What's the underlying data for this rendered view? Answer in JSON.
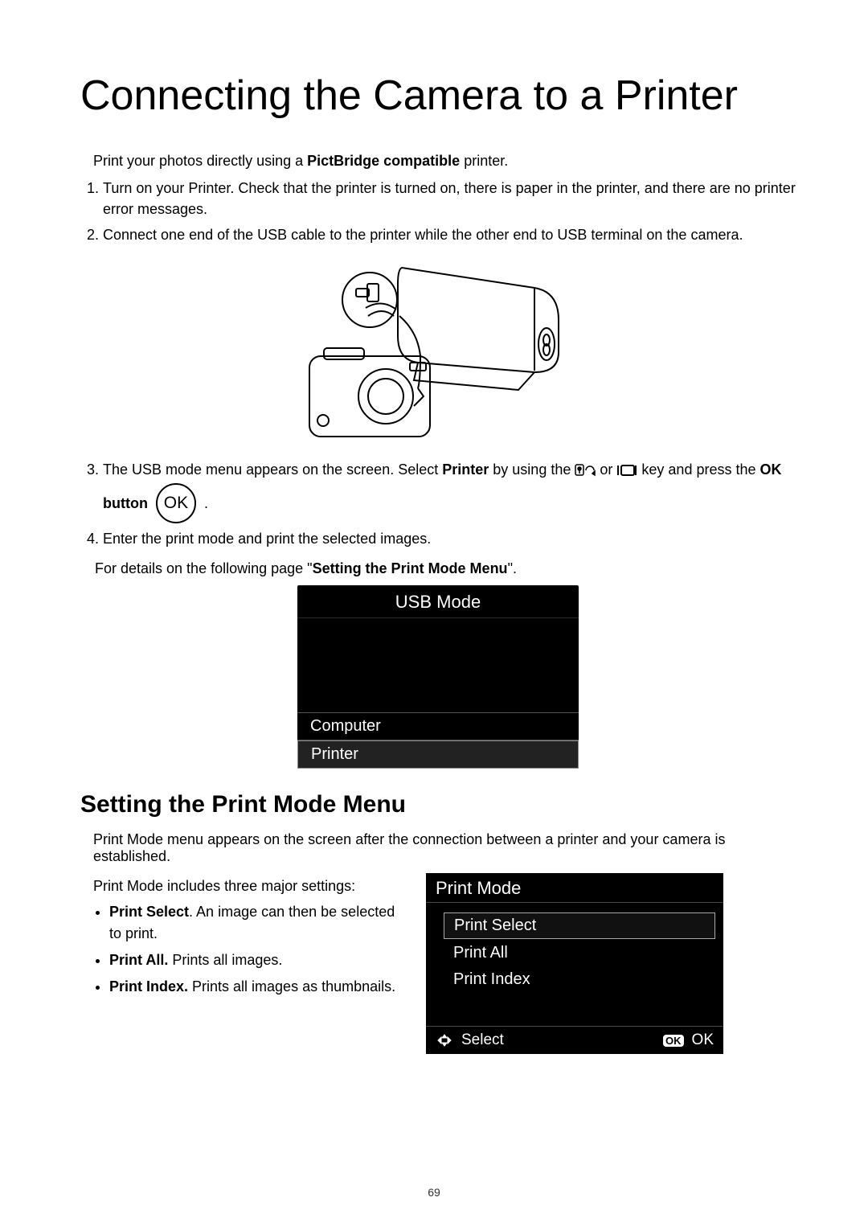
{
  "title": "Connecting the Camera to a Printer",
  "lead_before": "Print your photos directly using a ",
  "lead_bold": "PictBridge compatible",
  "lead_after": " printer.",
  "steps": {
    "s1": "Turn on your Printer. Check that the printer is turned on, there is paper in the printer, and there are no printer error messages.",
    "s2": "Connect one end of the USB cable to the printer while the other end to USB terminal on the camera.",
    "s3_a": "The USB mode menu appears on the screen. Select ",
    "s3_b_bold": "Printer",
    "s3_c": " by using the ",
    "s3_d": " or ",
    "s3_e": " key and press the ",
    "s3_f_bold": "OK",
    "s3_button_bold": "button",
    "s3_ok_label": "OK",
    "s3_period": ".",
    "s4": "Enter the print mode and print the selected images."
  },
  "details_before": "For details on the following page \"",
  "details_bold": "Setting the Print Mode Menu",
  "details_after": "\".",
  "usb_screen": {
    "title": "USB Mode",
    "computer": "Computer",
    "printer": "Printer"
  },
  "section2_title": "Setting the Print Mode Menu",
  "section2_p1": "Print Mode menu appears on the screen after the connection between a printer and your camera is established.",
  "section2_p2": "Print Mode includes three major settings:",
  "bullets": {
    "b1_bold": "Print Select",
    "b1_rest": ". An image can then be selected to print.",
    "b2_bold": "Print All.",
    "b2_rest": " Prints all images.",
    "b3_bold": "Print Index.",
    "b3_rest": " Prints all images as thumbnails."
  },
  "print_screen": {
    "title": "Print Mode",
    "opt1": "Print Select",
    "opt2": "Print All",
    "opt3": "Print Index",
    "foot_select": "Select",
    "foot_ok_badge": "OK",
    "foot_ok": "OK"
  },
  "page_number": "69"
}
